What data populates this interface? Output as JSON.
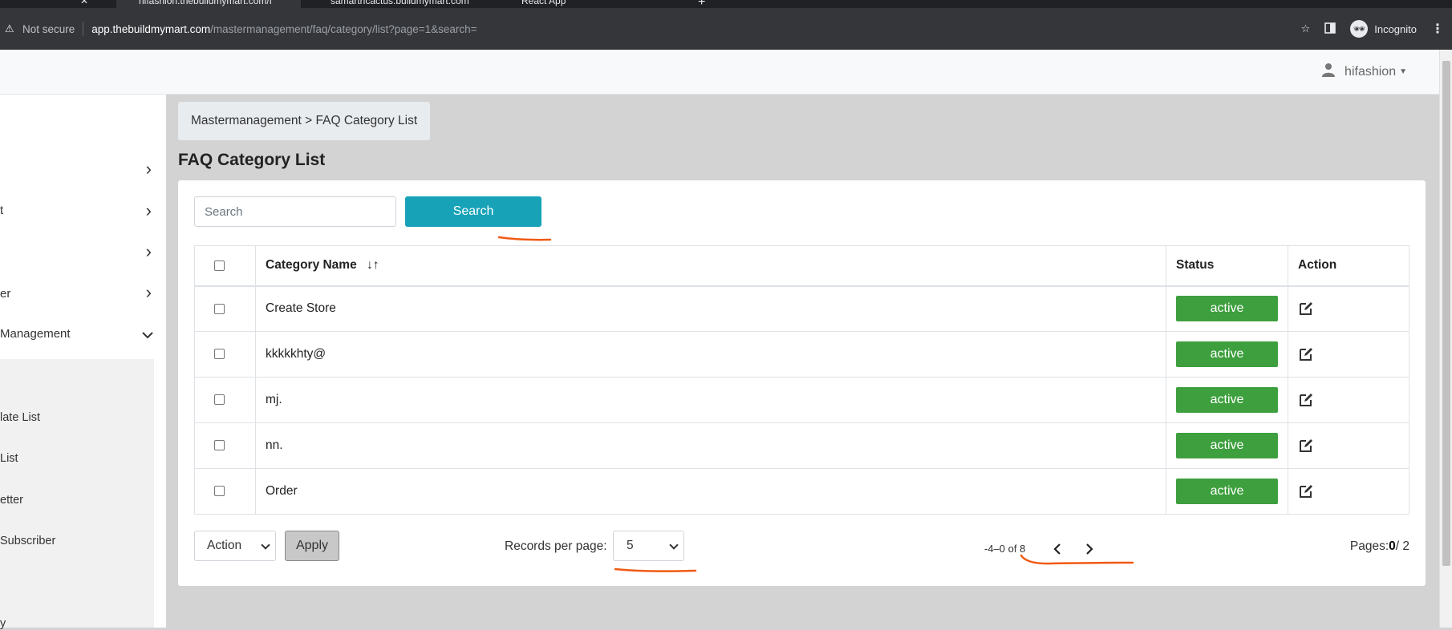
{
  "browser": {
    "tabs": [
      {
        "label": "hifashion.thebuildmymart.com/f"
      },
      {
        "label": "samarthcactus.buildmymart.com"
      },
      {
        "label": "React App"
      }
    ],
    "security": "Not secure",
    "url_host": "app.thebuildmymart.com",
    "url_path": "/mastermanagement/faq/category/list?page=1&search=",
    "incognito_label": "Incognito"
  },
  "header": {
    "username": "hifashion"
  },
  "sidebar": {
    "items": [
      {
        "label": ""
      },
      {
        "label": "t"
      },
      {
        "label": ""
      },
      {
        "label": "er"
      },
      {
        "label": " Management"
      }
    ],
    "subitems": [
      {
        "label": "late List"
      },
      {
        "label": " List"
      },
      {
        "label": "etter"
      },
      {
        "label": " Subscriber"
      },
      {
        "label": "y"
      }
    ]
  },
  "breadcrumb": {
    "text": "Mastermanagement > FAQ Category List"
  },
  "page": {
    "title": "FAQ Category List"
  },
  "search": {
    "placeholder": "Search",
    "button_label": "Search"
  },
  "table": {
    "headers": {
      "category": "Category Name",
      "sort_icon": "↓↑",
      "status": "Status",
      "action": "Action"
    },
    "rows": [
      {
        "name": "Create Store",
        "status": "active"
      },
      {
        "name": "kkkkkhty@",
        "status": "active"
      },
      {
        "name": "mj.",
        "status": "active"
      },
      {
        "name": "nn.",
        "status": "active"
      },
      {
        "name": "Order",
        "status": "active"
      }
    ]
  },
  "footer": {
    "action_select": "Action",
    "apply_label": "Apply",
    "records_label": "Records per page:",
    "records_value": "5",
    "range": "-4–0 of 8",
    "pages_label": "Pages:",
    "pages_current": "0",
    "pages_total": "/ 2"
  },
  "colors": {
    "search_button": "#17a2b8",
    "status_active": "#3e9f3e",
    "annotation": "#f05a14"
  }
}
